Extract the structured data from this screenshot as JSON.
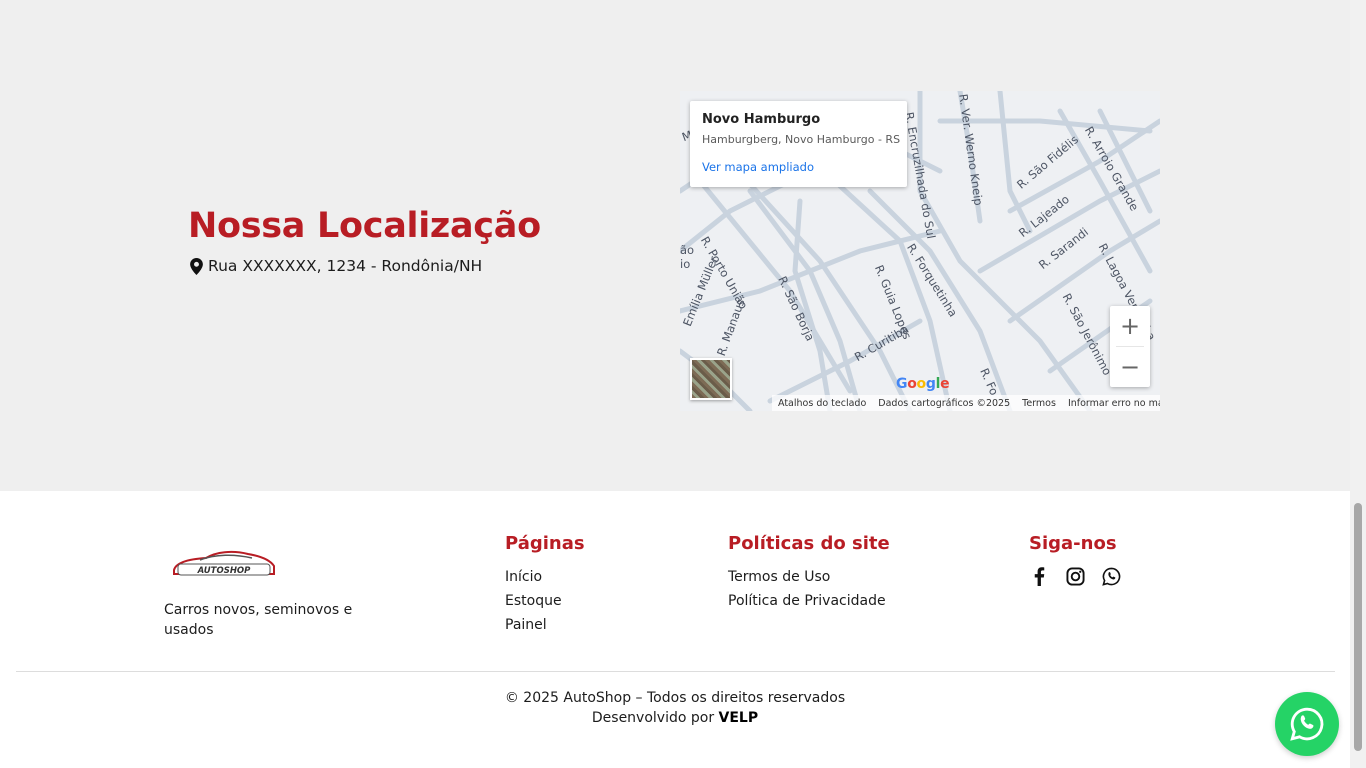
{
  "location": {
    "title": "Nossa Localização",
    "address": "Rua XXXXXXX, 1234 - Rondônia/NH",
    "address_icon": "map-pin-icon"
  },
  "map": {
    "place_name": "Novo Hamburgo",
    "place_sub": "Hamburgberg, Novo Hamburgo - RS",
    "enlarge_link": "Ver mapa ampliado",
    "zoom_in": "+",
    "zoom_out": "−",
    "logo_letters": [
      "G",
      "o",
      "o",
      "g",
      "l",
      "e"
    ],
    "footer": [
      "Atalhos do teclado",
      "Dados cartográficos ©2025",
      "Termos",
      "Informar erro no mapa"
    ],
    "streets": [
      "R. Encruzilhada do Sul",
      "R. Ver. Werno Kneip",
      "R. São Fidélis",
      "R. Arroio Grande",
      "R. Lajeado",
      "R. Sarandi",
      "R. Lagoa Vermelha",
      "R. Porto União",
      "R. Manaus",
      "R. São Borja",
      "R. Guia Lopes",
      "R. Forquetinha",
      "R. Curitiba",
      "R. São Jerônimo",
      "R. Fo",
      "Emília Müller",
      "ão",
      "io",
      "Ma",
      "R. Encru"
    ]
  },
  "footer": {
    "logo_text": "AUTOSHOP",
    "tagline": "Carros novos, seminovos e usados",
    "pages_title": "Páginas",
    "pages": [
      "Início",
      "Estoque",
      "Painel"
    ],
    "policies_title": "Políticas do site",
    "policies": [
      "Termos de Uso",
      "Política de Privacidade"
    ],
    "social_title": "Siga-nos",
    "social_icons": [
      "facebook-icon",
      "instagram-icon",
      "whatsapp-icon"
    ],
    "copyright": "© 2025 AutoShop – Todos os direitos reservados",
    "dev_prefix": "Desenvolvido por",
    "dev_name": "VELP"
  },
  "floating_button": {
    "icon": "whatsapp-icon"
  },
  "colors": {
    "brand_red": "#b81d24",
    "whatsapp_green": "#25d366",
    "link_blue": "#1a73e8"
  }
}
